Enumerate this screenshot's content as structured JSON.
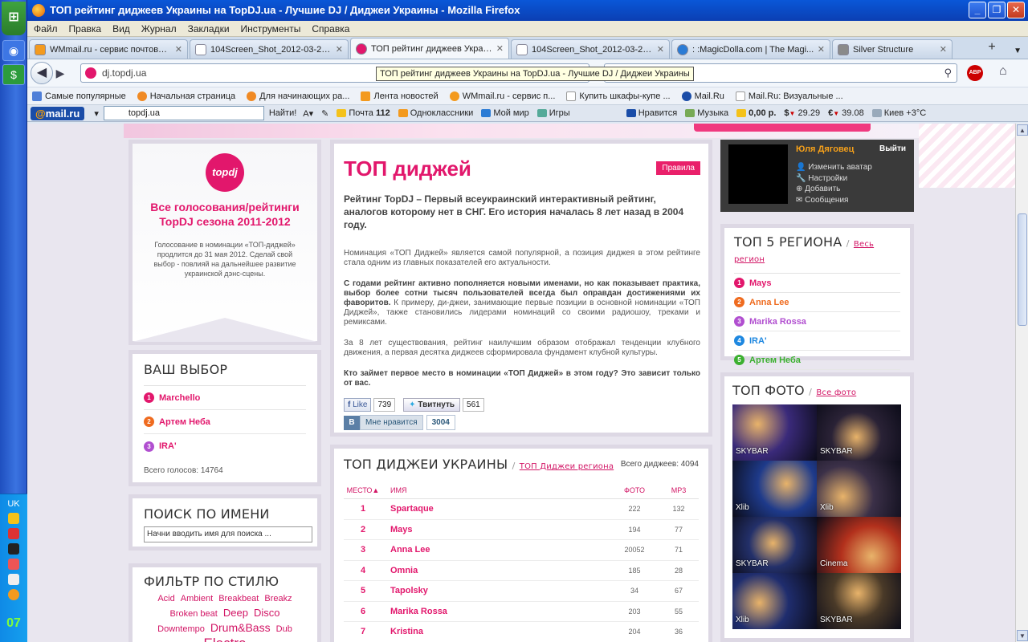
{
  "browser": {
    "title": "ТОП рейтинг диджеев Украины на TopDJ.ua - Лучшие DJ / Диджеи Украины - Mozilla Firefox",
    "menu": [
      "Файл",
      "Правка",
      "Вид",
      "Журнал",
      "Закладки",
      "Инструменты",
      "Справка"
    ],
    "tabs": [
      {
        "label": "WMmail.ru - сервис почтовых ...",
        "color": "#f39a1e"
      },
      {
        "label": "104Screen_Shot_2012-03-28_...",
        "color": "#ffffff"
      },
      {
        "label": "ТОП рейтинг диджеев Украи...",
        "color": "#e2176c"
      },
      {
        "label": "104Screen_Shot_2012-03-28_...",
        "color": "#ffffff"
      },
      {
        "label": ": :MagicDolla.com | The Magi...",
        "color": "#2a7bd5"
      },
      {
        "label": "Silver Structure",
        "color": "#8a8a8a"
      }
    ],
    "url": "dj.topdj.ua",
    "tooltip": "ТОП рейтинг диджеев Украины на TopDJ.ua - Лучшие DJ / Диджеи Украины",
    "bookmarks": [
      {
        "label": "Самые популярные",
        "color": "#4f7fd8"
      },
      {
        "label": "Начальная страница",
        "color": "#f08a24"
      },
      {
        "label": "Для начинающих ра...",
        "color": "#f08a24"
      },
      {
        "label": "Лента новостей",
        "color": "#f39a1e"
      },
      {
        "label": "WMmail.ru - сервис п...",
        "color": "#f39a1e"
      },
      {
        "label": "Купить шкафы-купе ...",
        "color": "#ffffff"
      },
      {
        "label": "Mail.Ru",
        "color": "#1a4da8"
      },
      {
        "label": "Mail.Ru: Визуальные ...",
        "color": "#ffffff"
      }
    ],
    "abp": "ABP"
  },
  "mailbar": {
    "logo_a": "@",
    "logo_b": "mail.ru",
    "search_value": "topdj.ua",
    "find": "Найти!",
    "mail_label": "Почта",
    "mail_count": "112",
    "items": [
      "Одноклассники",
      "Мой мир",
      "Игры",
      "Нравится",
      "Музыка"
    ],
    "balance": "0,00 р.",
    "usd": "29.29",
    "eur": "39.08",
    "weather": "Киев +3°C"
  },
  "taskbar": {
    "lang": "UK",
    "clock": "07"
  },
  "promo": {
    "logo": "topdj",
    "title": "Все голосования/рейтинги TopDJ сезона 2011-2012",
    "text": "Голосование в номинации «ТОП-диджей» продлится до 31 мая 2012. Сделай свой выбор - повлияй на дальнейшее развитие украинской дэнс-сцены."
  },
  "choice": {
    "title": "ВАШ ВЫБОР",
    "items": [
      {
        "num": "1",
        "name": "Marchello",
        "color": "#e2176c"
      },
      {
        "num": "2",
        "name": "Артем Неба",
        "color": "#ef6b1f"
      },
      {
        "num": "3",
        "name": "IRA'",
        "color": "#b14fd0"
      }
    ],
    "total": "Всего голосов: 14764"
  },
  "search": {
    "title": "ПОИСК ПО ИМЕНИ",
    "placeholder": "Начни вводить имя для поиска ..."
  },
  "filter": {
    "title": "ФИЛЬТР ПО СТИЛЮ",
    "tags": [
      {
        "label": "Acid",
        "size": "11px"
      },
      {
        "label": "Ambient",
        "size": "11px"
      },
      {
        "label": "Breakbeat",
        "size": "11px"
      },
      {
        "label": "Breakz",
        "size": "11px"
      },
      {
        "label": "Broken beat",
        "size": "11px"
      },
      {
        "label": "Deep",
        "size": "13px"
      },
      {
        "label": "Disco",
        "size": "13px"
      },
      {
        "label": "Downtempo",
        "size": "11px"
      },
      {
        "label": "Drum&Bass",
        "size": "14px"
      },
      {
        "label": "Dub",
        "size": "11px"
      },
      {
        "label": "Electro",
        "size": "17px"
      }
    ]
  },
  "main": {
    "title": "ТОП диджей",
    "rules": "Правила",
    "lead": "Рейтинг TopDJ – Первый всеукраинский интерактивный рейтинг, аналогов которому нет в СНГ. Его история началась 8 лет назад в 2004 году.",
    "p1": "Номинация «ТОП Диджей» является самой популярной, а позиция диджея в этом рейтинге стала одним из главных показателей его актуальности.",
    "p2_bold": "С годами рейтинг активно пополняется новыми именами, но как показывает практика, выбор более сотни тысяч пользователей всегда был оправдан достижениями их фаворитов.",
    "p2_rest": " К примеру, ди-джеи, занимающие первые позиции в основной номинации «ТОП Диджей», также становились лидерами номинаций со своими радиошоу, треками и ремиксами.",
    "p3": "За 8 лет существования, рейтинг наилучшим образом отображал тенденции клубного движения, а первая десятка диджеев сформировала фундамент клубной культуры.",
    "p4": "Кто займет первое место в номинации «ТОП Диджей» в этом году? Это зависит только от вас.",
    "fb_like": "Like",
    "fb_count": "739",
    "tweet": "Твитнуть",
    "tweet_count": "561",
    "vk_logo": "В",
    "vk_like": "Мне нравится",
    "vk_count": "3004"
  },
  "top_ua": {
    "title": "ТОП ДИДЖЕИ УКРАИНЫ",
    "region_link": "ТОП Диджеи региона",
    "total": "Всего диджеев: 4094",
    "headers": {
      "place": "МЕСТО▲",
      "name": "ИМЯ",
      "photo": "ФОТО",
      "mp3": "MP3"
    },
    "rows": [
      {
        "place": "1",
        "name": "Spartaque",
        "photo": "222",
        "mp3": "132"
      },
      {
        "place": "2",
        "name": "Mays",
        "photo": "194",
        "mp3": "77"
      },
      {
        "place": "3",
        "name": "Anna Lee",
        "photo": "20052",
        "mp3": "71"
      },
      {
        "place": "4",
        "name": "Omnia",
        "photo": "185",
        "mp3": "28"
      },
      {
        "place": "5",
        "name": "Tapolsky",
        "photo": "34",
        "mp3": "67"
      },
      {
        "place": "6",
        "name": "Marika Rossa",
        "photo": "203",
        "mp3": "55"
      },
      {
        "place": "7",
        "name": "Kristina",
        "photo": "204",
        "mp3": "36"
      }
    ]
  },
  "user": {
    "name": "Юля Дяговец",
    "exit": "Выйти",
    "menu": [
      "Изменить аватар",
      "Настройки",
      "Добавить",
      "Сообщения"
    ]
  },
  "regions": {
    "title": "ТОП 5 РЕГИОНА",
    "link": "Весь регион",
    "items": [
      {
        "num": "1",
        "name": "Mays",
        "color": "#e2176c"
      },
      {
        "num": "2",
        "name": "Anna Lee",
        "color": "#ef6b1f"
      },
      {
        "num": "3",
        "name": "Marika Rossa",
        "color": "#b14fd0"
      },
      {
        "num": "4",
        "name": "IRA'",
        "color": "#1f88e0"
      },
      {
        "num": "5",
        "name": "Артем Неба",
        "color": "#3cb030"
      }
    ]
  },
  "photos": {
    "title": "ТОП ФОТО",
    "link": "Все фото",
    "items": [
      {
        "caption": "SKYBAR",
        "color": "#3a2a7a"
      },
      {
        "caption": "SKYBAR",
        "color": "#2a2236"
      },
      {
        "caption": "Xlib",
        "color": "#1e3a8a"
      },
      {
        "caption": "Xlib",
        "color": "#3b3048"
      },
      {
        "caption": "SKYBAR",
        "color": "#23306a"
      },
      {
        "caption": "Cinema",
        "color": "#b2301c"
      },
      {
        "caption": "Xlib",
        "color": "#1f2d6e"
      },
      {
        "caption": "SKYBAR",
        "color": "#4a3a28"
      }
    ]
  }
}
